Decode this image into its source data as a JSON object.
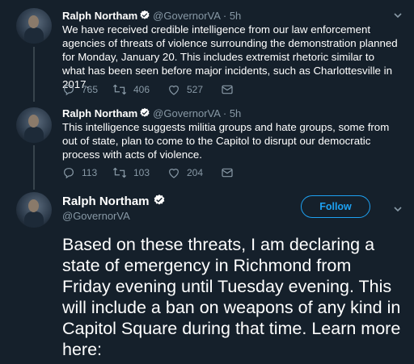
{
  "tweets": [
    {
      "name": "Ralph Northam",
      "handle": "@GovernorVA",
      "dot": "·",
      "time": "5h",
      "text": "We have received credible intelligence from our law enforcement agencies of threats of violence surrounding the demonstration planned for Monday, January 20. This includes extremist rhetoric similar to what has been seen before major incidents, such as Charlottesville in 2017.",
      "replies": "765",
      "retweets": "406",
      "likes": "527"
    },
    {
      "name": "Ralph Northam",
      "handle": "@GovernorVA",
      "dot": "·",
      "time": "5h",
      "text": "This intelligence suggests militia groups and hate groups, some from out of state, plan to come to the Capitol to disrupt our democratic process with acts of violence.",
      "replies": "113",
      "retweets": "103",
      "likes": "204"
    }
  ],
  "main_tweet": {
    "name": "Ralph Northam",
    "handle": "@GovernorVA",
    "follow_label": "Follow",
    "text": "Based on these threats, I am declaring a state of emergency in Richmond from Friday evening until Tuesday evening. This will include a ban on weapons of any kind in Capitol Square during that time. Learn more here:"
  },
  "colors": {
    "background": "#15202b",
    "accent": "#1da1f2",
    "muted": "#8899a6"
  },
  "icons": [
    "verified-badge-icon",
    "chevron-down-icon",
    "reply-icon",
    "retweet-icon",
    "like-icon",
    "share-icon"
  ]
}
